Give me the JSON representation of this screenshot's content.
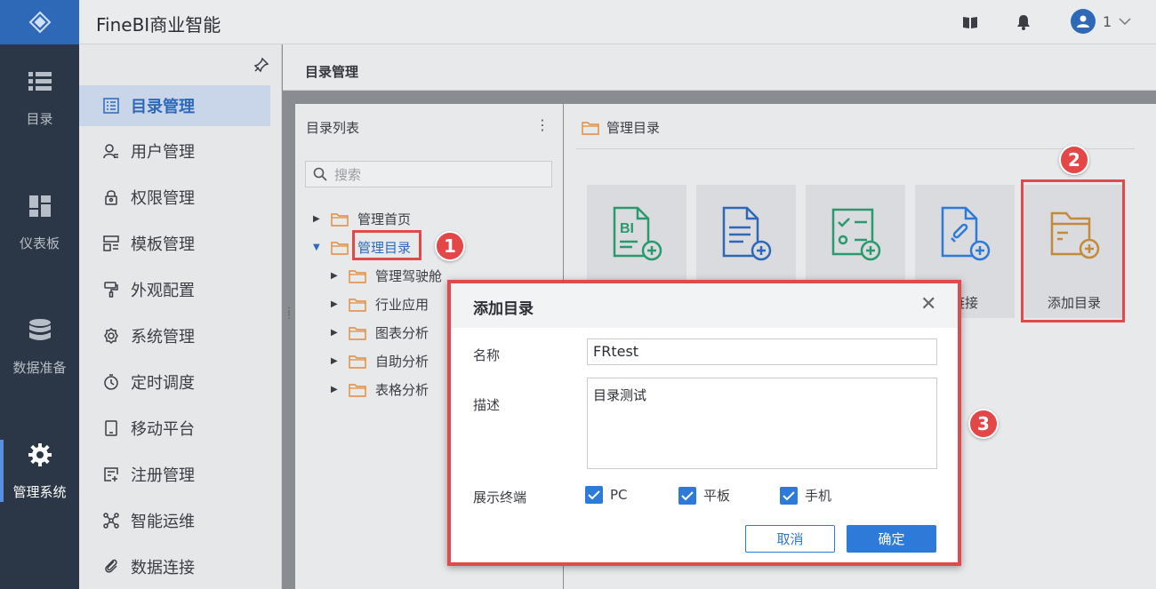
{
  "app": {
    "title": "FineBI商业智能"
  },
  "user": {
    "name": "1"
  },
  "rail": {
    "items": [
      {
        "label": "目录",
        "icon": "list-icon"
      },
      {
        "label": "仪表板",
        "icon": "dashboard-icon"
      },
      {
        "label": "数据准备",
        "icon": "database-icon"
      },
      {
        "label": "管理系统",
        "icon": "gear-icon",
        "active": true
      }
    ]
  },
  "sidebar": {
    "items": [
      {
        "label": "目录管理",
        "icon": "catalog-icon",
        "active": true
      },
      {
        "label": "用户管理",
        "icon": "user-icon"
      },
      {
        "label": "权限管理",
        "icon": "lock-icon"
      },
      {
        "label": "模板管理",
        "icon": "template-icon"
      },
      {
        "label": "外观配置",
        "icon": "brush-icon"
      },
      {
        "label": "系统管理",
        "icon": "settings-icon"
      },
      {
        "label": "定时调度",
        "icon": "timer-icon"
      },
      {
        "label": "移动平台",
        "icon": "mobile-icon"
      },
      {
        "label": "注册管理",
        "icon": "register-icon"
      },
      {
        "label": "智能运维",
        "icon": "ops-icon"
      },
      {
        "label": "数据连接",
        "icon": "link-icon"
      }
    ]
  },
  "content": {
    "title": "目录管理"
  },
  "tree": {
    "title": "目录列表",
    "search_placeholder": "搜索",
    "nodes": [
      {
        "label": "管理首页",
        "level": 0,
        "expanded": false
      },
      {
        "label": "管理目录",
        "level": 0,
        "expanded": true,
        "selected": true
      },
      {
        "label": "管理驾驶舱",
        "level": 1
      },
      {
        "label": "行业应用",
        "level": 1
      },
      {
        "label": "图表分析",
        "level": 1
      },
      {
        "label": "自助分析",
        "level": 1
      },
      {
        "label": "表格分析",
        "level": 1
      }
    ]
  },
  "right_panel": {
    "title": "管理目录",
    "cards": [
      {
        "label": "",
        "icon": "bi-file-add-icon"
      },
      {
        "label": "",
        "icon": "doc-add-icon"
      },
      {
        "label": "",
        "icon": "form-add-icon"
      },
      {
        "label": "链接",
        "icon": "link-add-icon"
      },
      {
        "label": "添加目录",
        "icon": "folder-add-icon"
      }
    ]
  },
  "callouts": [
    "1",
    "2",
    "3"
  ],
  "modal": {
    "title": "添加目录",
    "name_label": "名称",
    "name_value": "FRtest",
    "desc_label": "描述",
    "desc_value": "目录测试",
    "terminal_label": "展示终端",
    "terminals": [
      {
        "label": "PC",
        "checked": true
      },
      {
        "label": "平板",
        "checked": true
      },
      {
        "label": "手机",
        "checked": true
      }
    ],
    "cancel_label": "取消",
    "ok_label": "确定"
  },
  "colors": {
    "accent": "#2e7ad9",
    "brand": "#2e69b8",
    "callout": "#e04a4a",
    "folder": "#e08a3c"
  }
}
